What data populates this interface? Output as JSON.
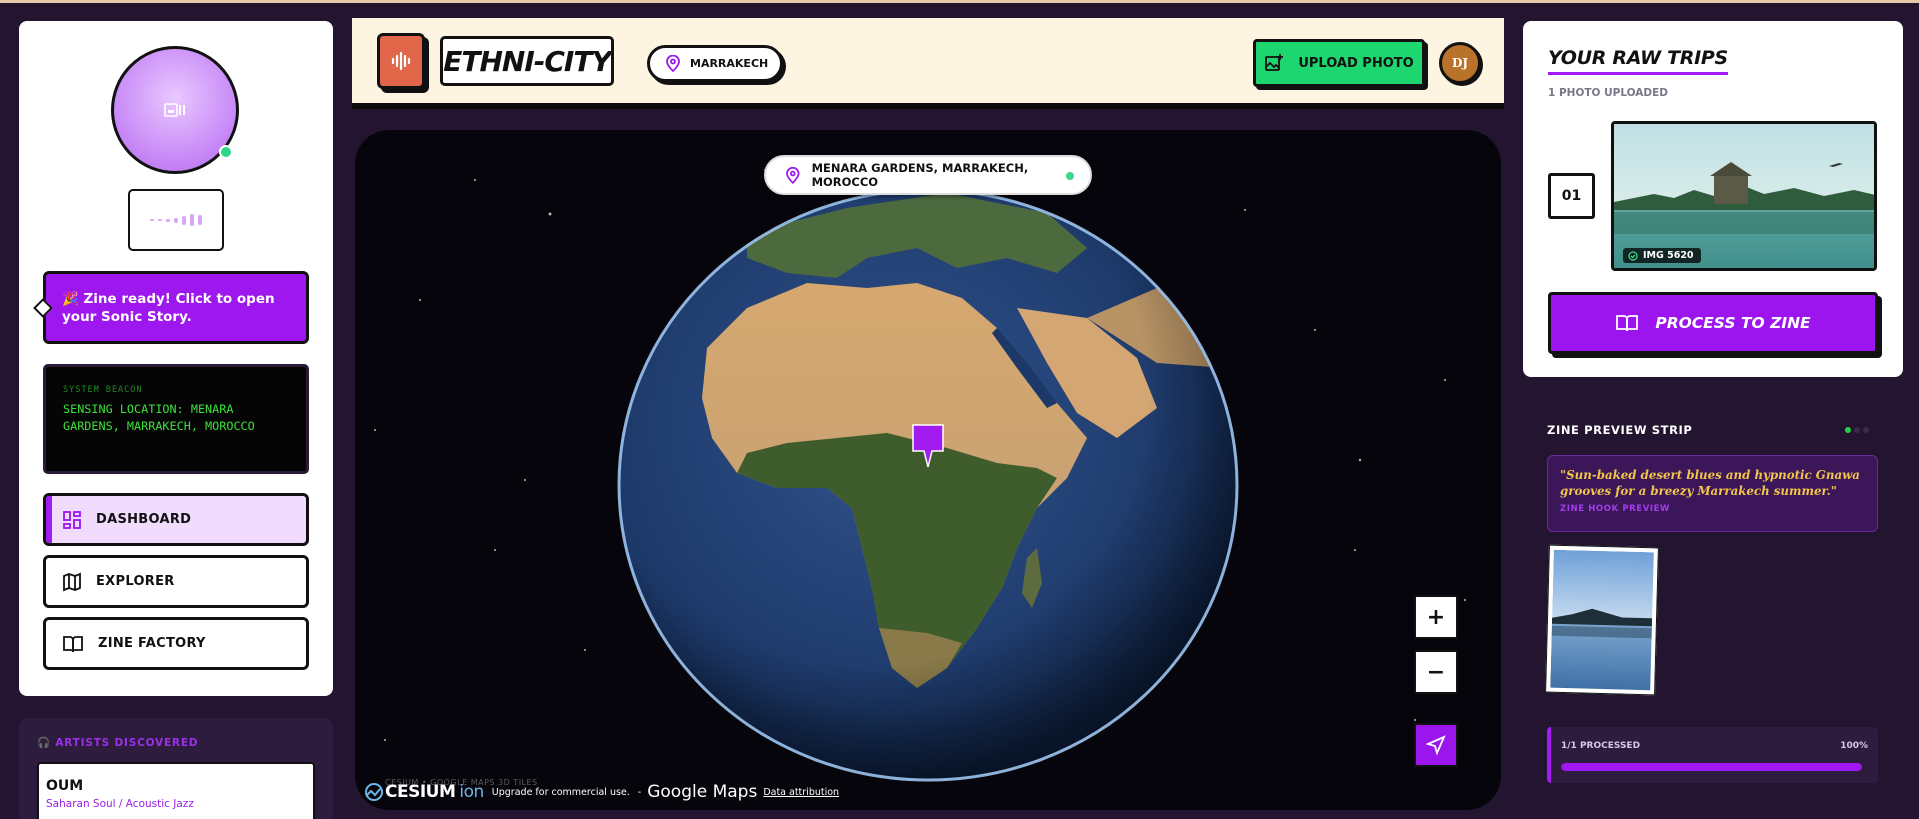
{
  "app": {
    "name": "ETHNI-CITY",
    "location_pill": "MARRAKECH",
    "upload_label": "UPLOAD PHOTO",
    "user_initials": "DJ"
  },
  "sidebar": {
    "zine_ready": "🎉 Zine ready! Click to open your Sonic Story.",
    "beacon_label": "SYSTEM BEACON",
    "beacon_text": "SENSING LOCATION: MENARA GARDENS, MARRAKECH, MOROCCO",
    "nav": [
      {
        "label": "DASHBOARD",
        "icon": "dashboard-icon",
        "active": true
      },
      {
        "label": "EXPLORER",
        "icon": "map-icon",
        "active": false
      },
      {
        "label": "ZINE FACTORY",
        "icon": "book-open-icon",
        "active": false
      }
    ],
    "artists_heading": "ARTISTS DISCOVERED",
    "artist": {
      "name": "OUM",
      "genre": "Saharan Soul / Acoustic Jazz"
    }
  },
  "map": {
    "location_label": "MENARA GARDENS, MARRAKECH, MOROCCO",
    "zoom_in": "+",
    "zoom_out": "−",
    "credit_cesium": "CESIUM",
    "credit_ion": "ion",
    "credit_upgrade": "Upgrade for commercial use.",
    "credit_sep": "-",
    "credit_google": "Google Maps",
    "credit_attr": "Data attribution",
    "credit_faint": "CESIUM • GOOGLE MAPS 3D TILES"
  },
  "trips": {
    "title": "YOUR RAW TRIPS",
    "subtitle": "1 PHOTO UPLOADED",
    "items": [
      {
        "index": "01",
        "label": "IMG 5620"
      }
    ],
    "process_label": "PROCESS TO ZINE"
  },
  "zine_strip": {
    "title": "ZINE PREVIEW STRIP",
    "quote": "\"Sun-baked desert blues and hypnotic Gnawa grooves for a breezy Marrakech summer.\"",
    "hook_label": "ZINE HOOK PREVIEW",
    "progress_label": "1/1 PROCESSED",
    "progress_pct": "100%",
    "progress_value": 1.0
  },
  "colors": {
    "accent": "#9c14ee",
    "success": "#1dd66f",
    "terminal": "#3be03b",
    "quote": "#f2c64a"
  }
}
